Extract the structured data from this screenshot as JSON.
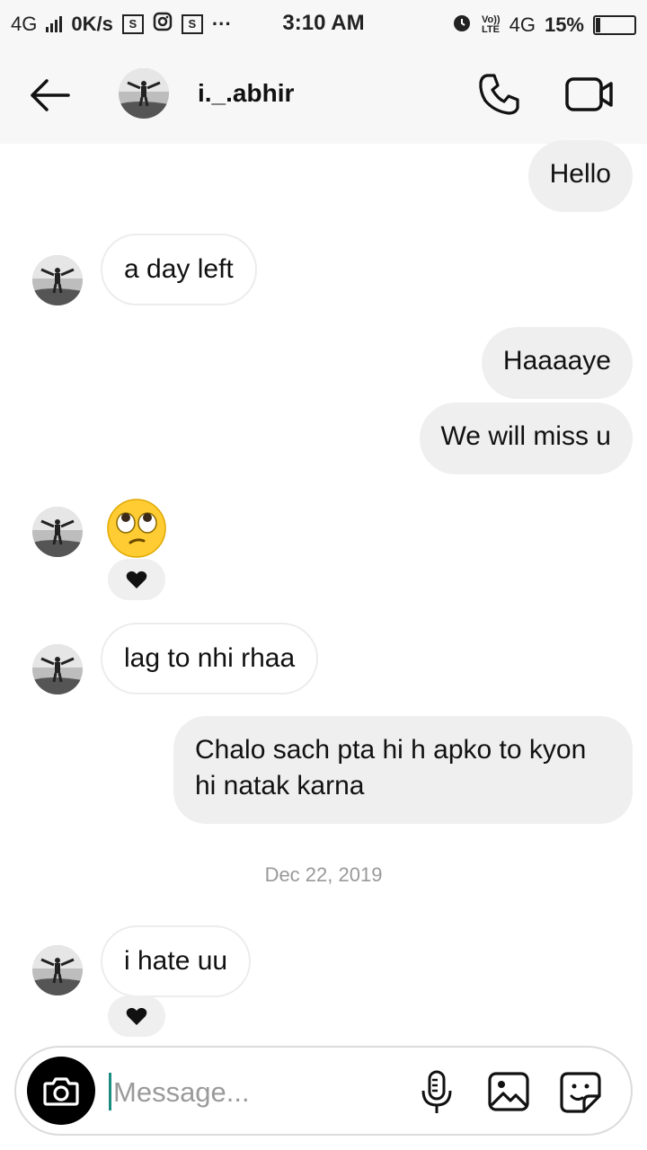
{
  "status_bar": {
    "network_left": "4G",
    "speed": "0K/s",
    "box1": "S",
    "box2": "S",
    "more": "···",
    "time": "3:10 AM",
    "volte_top": "Vo))",
    "volte_bottom": "LTE",
    "network_right": "4G",
    "battery": "15%"
  },
  "header": {
    "username": "i._.abhir"
  },
  "messages": [
    {
      "side": "out",
      "text": "Hello"
    },
    {
      "side": "in",
      "text": "a day left"
    },
    {
      "side": "out",
      "text": "Haaaaye"
    },
    {
      "side": "out",
      "text": "We will miss u"
    },
    {
      "side": "in",
      "emoji": "face-with-rolling-eyes",
      "reaction": "heart"
    },
    {
      "side": "in",
      "text": "lag to nhi rhaa"
    },
    {
      "side": "out",
      "text": "Chalo sach pta hi h apko to kyon hi natak karna"
    },
    {
      "side": "in",
      "text": "i hate uu",
      "reaction": "heart"
    }
  ],
  "date_separator": "Dec 22, 2019",
  "composer": {
    "placeholder": "Message..."
  },
  "colors": {
    "outgoing_bubble": "#efefef",
    "incoming_border": "#ececec",
    "cursor": "#1a8d80",
    "emoji_yellow": "#ffcc33"
  },
  "icons": {
    "back": "arrow-left-icon",
    "call": "phone-icon",
    "video": "video-camera-icon",
    "camera": "camera-icon",
    "mic": "microphone-icon",
    "gallery": "image-icon",
    "sticker": "sticker-icon",
    "reaction": "heart-icon"
  }
}
